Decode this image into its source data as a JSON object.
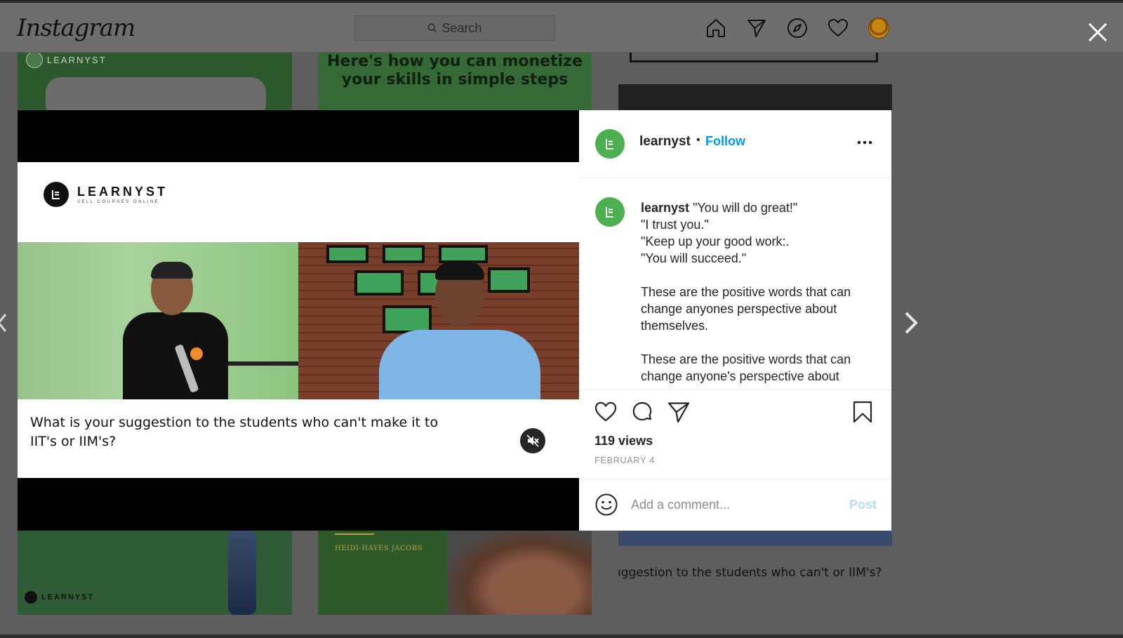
{
  "app": {
    "logo": "Instagram",
    "search_placeholder": "Search"
  },
  "nav_icons": [
    "home-icon",
    "direct-icon",
    "explore-icon",
    "activity-heart-icon",
    "profile-avatar"
  ],
  "background_tiles": {
    "tile_a_logo": "LEARNYST",
    "tile_a_sub": "SELL COURSES ONLINE",
    "tile_b_title": "Here's how you can monetize your skills in simple steps",
    "tile_d_logo": "LEARNYST",
    "tile_e_name": "HEIDI-HAYES JACOBS",
    "tile_f_caption": "ıggestion to the students who can't or IIM's?"
  },
  "post": {
    "slide_logo": "LEARNYST",
    "slide_logo_sub": "SELL COURSES ONLINE",
    "question": "What is your suggestion to the students who can't make it to IIT's or IIM's?",
    "username": "learnyst",
    "follow_label": "Follow",
    "separator": "•",
    "caption_lines": [
      "\"You will do great!\"",
      "\"I trust you.\"",
      "\"Keep up your good work:.",
      "\"You will succeed.\""
    ],
    "caption_para1": "These are the positive words that can change anyones perspective about themselves.",
    "caption_para2": "These are the positive words that can change anyone's perspective about",
    "views": "119 views",
    "date": "FEBRUARY 4",
    "comment_placeholder": "Add a comment...",
    "post_label": "Post"
  },
  "colors": {
    "accent": "#0095f6",
    "avatar": "#4caf50",
    "post_disabled": "#b2dffc"
  }
}
